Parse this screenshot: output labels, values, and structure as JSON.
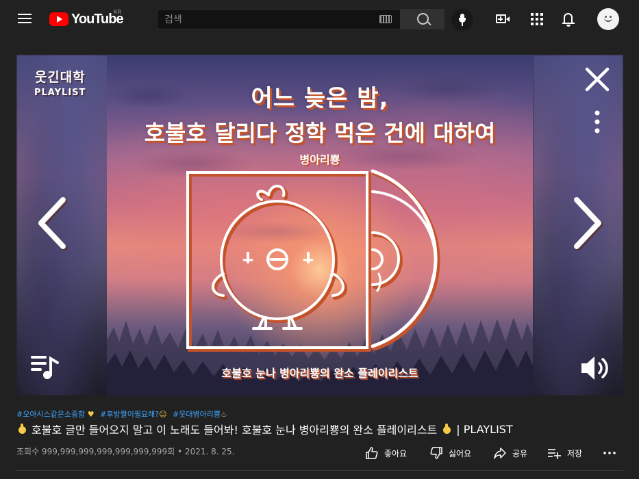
{
  "header": {
    "logo_text": "YouTube",
    "region": "KR",
    "search_placeholder": "검색"
  },
  "player": {
    "brand_line1": "웃긴대학",
    "brand_line2": "PLAYLIST",
    "art_title_line1": "어느 늦은 밤,",
    "art_title_line2": "호불호 달리다 정학 먹은 건에 대하여",
    "art_artist": "병아리뿅",
    "art_caption": "호불호 눈나 병아리뿅의 완소 플레이리스트"
  },
  "video": {
    "hashtags": [
      "#오아시스같은소중함",
      "#후방짤이필요해?",
      "#웃대병아리뿅"
    ],
    "title": "호불호 글만 들어오지 말고 이 노래도 들어봐! 호불호 눈나 병아리뿅의 완소 플레이리스트",
    "title_suffix": "| PLAYLIST",
    "views": "조회수 999,999,999,999,999,999,999회",
    "date": "2021. 8. 25."
  },
  "actions": {
    "like": "좋아요",
    "dislike": "싫어요",
    "share": "공유",
    "save": "저장"
  },
  "icons": [
    "menu-icon",
    "youtube-logo-icon",
    "keyboard-icon",
    "search-icon",
    "mic-icon",
    "create-video-icon",
    "apps-icon",
    "bell-icon",
    "avatar-icon",
    "close-icon",
    "more-vertical-icon",
    "chevron-left-icon",
    "chevron-right-icon",
    "playlist-music-icon",
    "volume-icon",
    "thumbs-up-icon",
    "thumbs-down-icon",
    "share-icon",
    "save-playlist-icon",
    "more-horizontal-icon"
  ],
  "colors": {
    "background": "#212121",
    "hashtag": "#3ea6ff",
    "brand_red": "#ff0000",
    "art_outline": "#c4522a"
  }
}
